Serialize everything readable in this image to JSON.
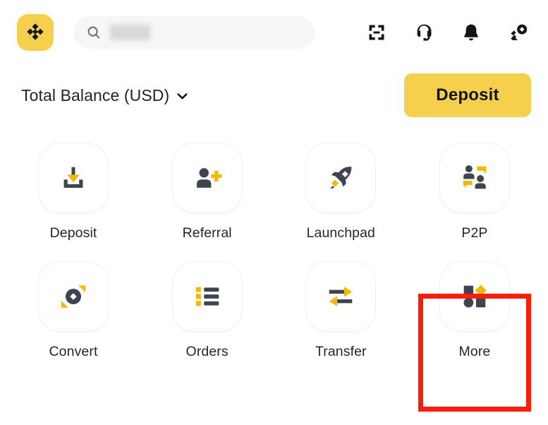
{
  "app": {
    "name": "Binance",
    "brand_yellow": "#F6D04C",
    "dark": "#3E4450",
    "highlight_color": "#FB1E06"
  },
  "header": {
    "logo_icon": "binance-logo-icon",
    "search": {
      "icon": "search-icon",
      "placeholder": "",
      "value": "",
      "redacted": true
    },
    "icons": [
      {
        "name": "qr-scan-icon",
        "label": "Scan"
      },
      {
        "name": "headset-support-icon",
        "label": "Support"
      },
      {
        "name": "bell-notification-icon",
        "label": "Notifications"
      },
      {
        "name": "hand-coin-rewards-icon",
        "label": "Rewards"
      }
    ]
  },
  "balance": {
    "label": "Total Balance (USD)",
    "chevron_icon": "chevron-down-icon",
    "deposit_label": "Deposit"
  },
  "grid": {
    "rows": [
      [
        {
          "label": "Deposit",
          "icon": "deposit-tray-icon"
        },
        {
          "label": "Referral",
          "icon": "referral-person-plus-icon"
        },
        {
          "label": "Launchpad",
          "icon": "launchpad-rocket-icon"
        },
        {
          "label": "P2P",
          "icon": "p2p-two-people-icon"
        }
      ],
      [
        {
          "label": "Convert",
          "icon": "convert-circle-arrows-icon"
        },
        {
          "label": "Orders",
          "icon": "orders-list-icon"
        },
        {
          "label": "Transfer",
          "icon": "transfer-arrows-icon"
        },
        {
          "label": "More",
          "icon": "more-shapes-icon",
          "highlighted": true
        }
      ]
    ]
  },
  "annotation": {
    "target": "More",
    "shape": "rectangle",
    "color": "#FB1E06"
  }
}
